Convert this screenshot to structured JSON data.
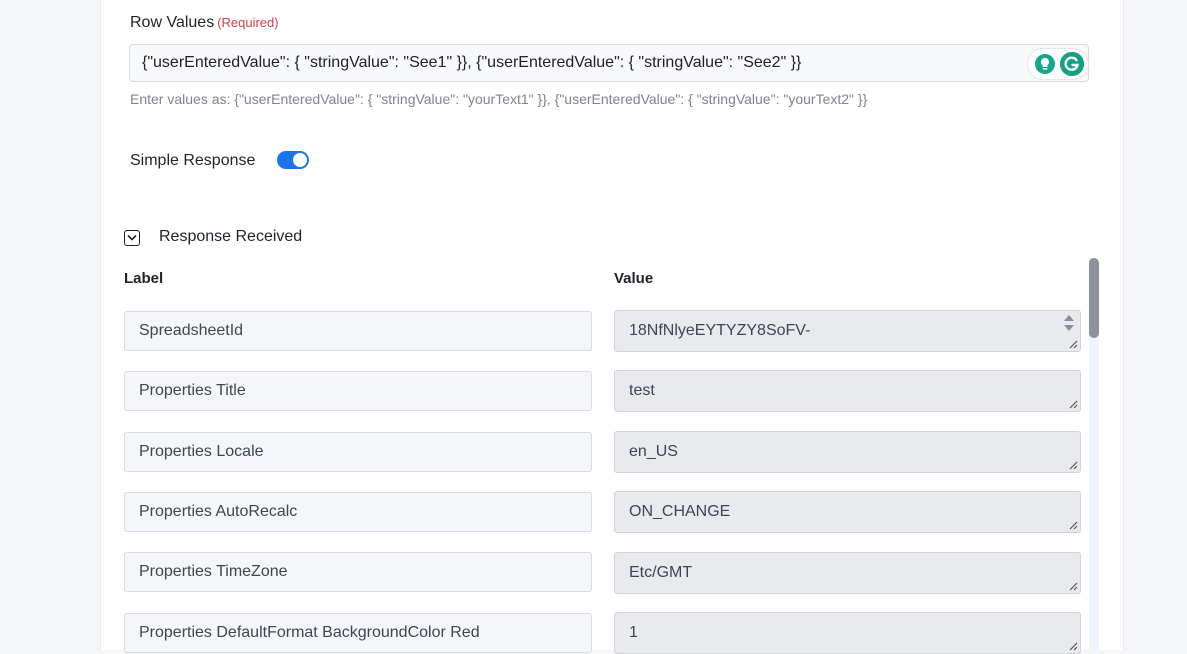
{
  "row_values": {
    "label": "Row Values",
    "required": "(Required)",
    "value": "{\"userEnteredValue\": { \"stringValue\": \"See1\" }}, {\"userEnteredValue\": { \"stringValue\": \"See2\" }}",
    "hint": "Enter values as: {\"userEnteredValue\": { \"stringValue\": \"yourText1\" }}, {\"userEnteredValue\": { \"stringValue\": \"yourText2\" }}"
  },
  "simple_response": {
    "label": "Simple Response",
    "enabled": true,
    "accent": "#1a73e8"
  },
  "response": {
    "title": "Response Received",
    "label_header": "Label",
    "value_header": "Value",
    "rows": [
      {
        "label": "SpreadsheetId",
        "value": "18NfNlyeEYTYZY8SoFV-"
      },
      {
        "label": "Properties Title",
        "value": "test"
      },
      {
        "label": "Properties Locale",
        "value": "en_US"
      },
      {
        "label": "Properties AutoRecalc",
        "value": "ON_CHANGE"
      },
      {
        "label": "Properties TimeZone",
        "value": "Etc/GMT"
      },
      {
        "label": "Properties DefaultFormat BackgroundColor Red",
        "value": "1"
      }
    ]
  },
  "icons": {
    "grammarly_bulb": "lightbulb-icon",
    "grammarly_logo": "grammarly-icon",
    "collapse": "chevron-down-icon"
  }
}
